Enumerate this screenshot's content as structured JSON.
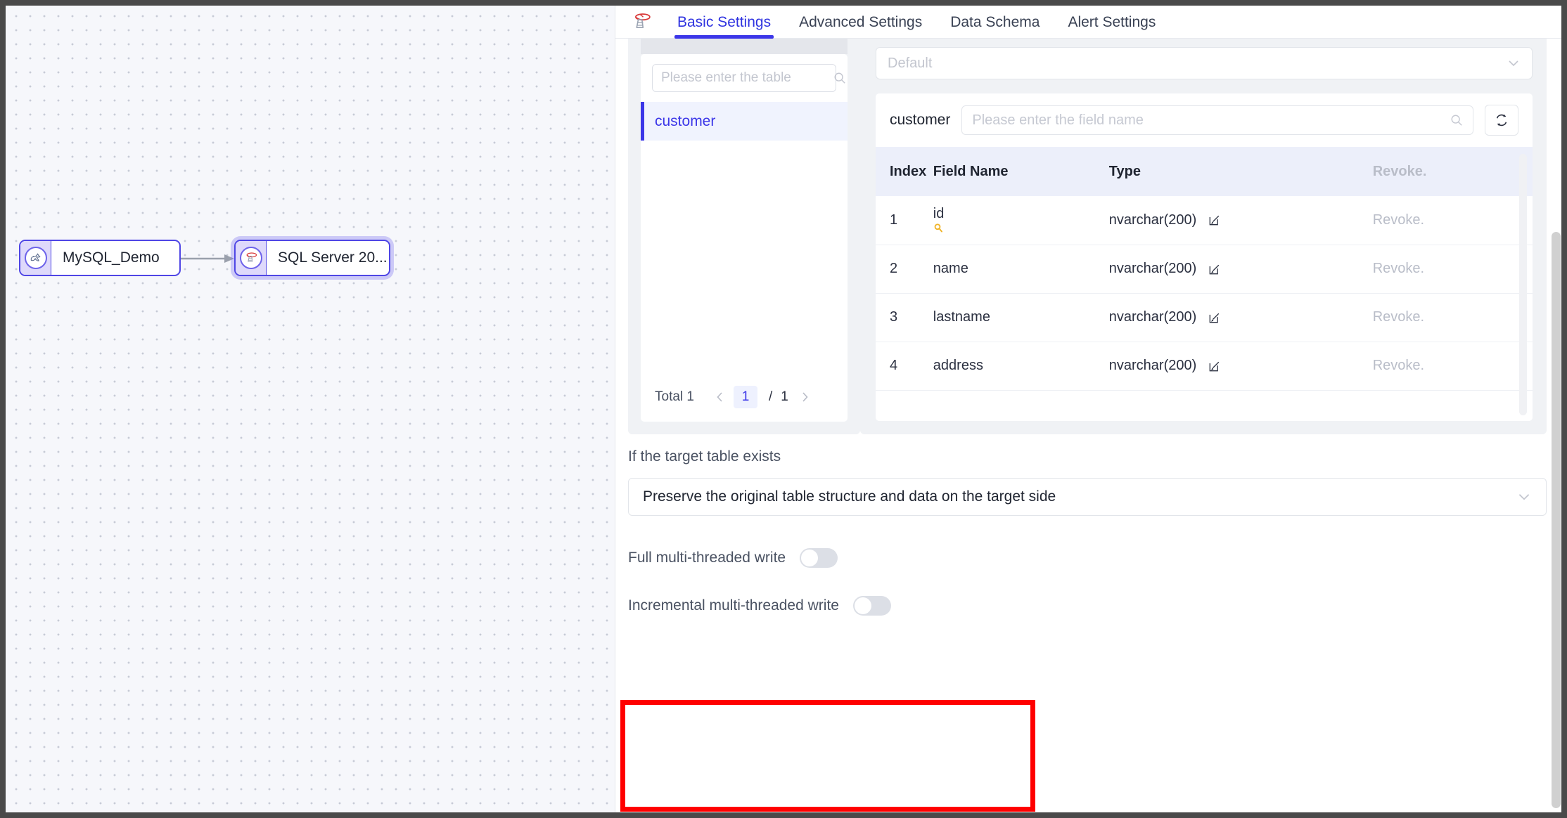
{
  "tabs": [
    {
      "label": "Basic Settings",
      "active": true
    },
    {
      "label": "Advanced Settings",
      "active": false
    },
    {
      "label": "Data Schema",
      "active": false
    },
    {
      "label": "Alert Settings",
      "active": false
    }
  ],
  "logo_icon": "sql-server-icon",
  "canvas": {
    "nodes": [
      {
        "label": "MySQL_Demo",
        "icon": "mysql-dolphin-icon",
        "selected": false
      },
      {
        "label": "SQL Server 20...",
        "icon": "sql-server-icon",
        "selected": true
      }
    ],
    "edge": "connector-arrow"
  },
  "table_list": {
    "search_placeholder": "Please enter the table",
    "search_value": "",
    "search_icon": "search-icon",
    "items": [
      {
        "label": "customer",
        "active": true
      }
    ],
    "pager": {
      "total_label": "Total 1",
      "prev_icon": "chevron-left-icon",
      "current_page": "1",
      "separator": "/",
      "total_pages": "1",
      "next_icon": "chevron-right-icon"
    }
  },
  "schema_panel": {
    "schema_select": {
      "value": "Default",
      "chevron_icon": "chevron-down-icon"
    },
    "table_name": "customer",
    "field_search_placeholder": "Please enter the field name",
    "field_search_value": "",
    "field_search_icon": "search-icon",
    "refresh_icon": "refresh-icon",
    "columns": [
      "Index",
      "Field Name",
      "Type",
      "Revoke."
    ],
    "rows": [
      {
        "index": "1",
        "field": "id",
        "key_icon": "primary-key-icon",
        "type": "nvarchar(200)",
        "edit_icon": "edit-icon",
        "revoke": "Revoke."
      },
      {
        "index": "2",
        "field": "name",
        "key_icon": "",
        "type": "nvarchar(200)",
        "edit_icon": "edit-icon",
        "revoke": "Revoke."
      },
      {
        "index": "3",
        "field": "lastname",
        "key_icon": "",
        "type": "nvarchar(200)",
        "edit_icon": "edit-icon",
        "revoke": "Revoke."
      },
      {
        "index": "4",
        "field": "address",
        "key_icon": "",
        "type": "nvarchar(200)",
        "edit_icon": "edit-icon",
        "revoke": "Revoke."
      }
    ]
  },
  "target_table": {
    "label": "If the target table exists",
    "select_value": "Preserve the original table structure and data on the target side",
    "chevron_icon": "chevron-down-icon"
  },
  "toggles": [
    {
      "label": "Full multi-threaded write",
      "on": false
    },
    {
      "label": "Incremental multi-threaded write",
      "on": false
    }
  ],
  "annotation": {
    "color": "#ff0000"
  },
  "colors": {
    "accent": "#3b36e8",
    "node_border": "#4f46e5",
    "panel_bg": "#f0f2f5",
    "canvas_bg": "#f6f7fb",
    "muted_text": "#b9bdc8"
  }
}
